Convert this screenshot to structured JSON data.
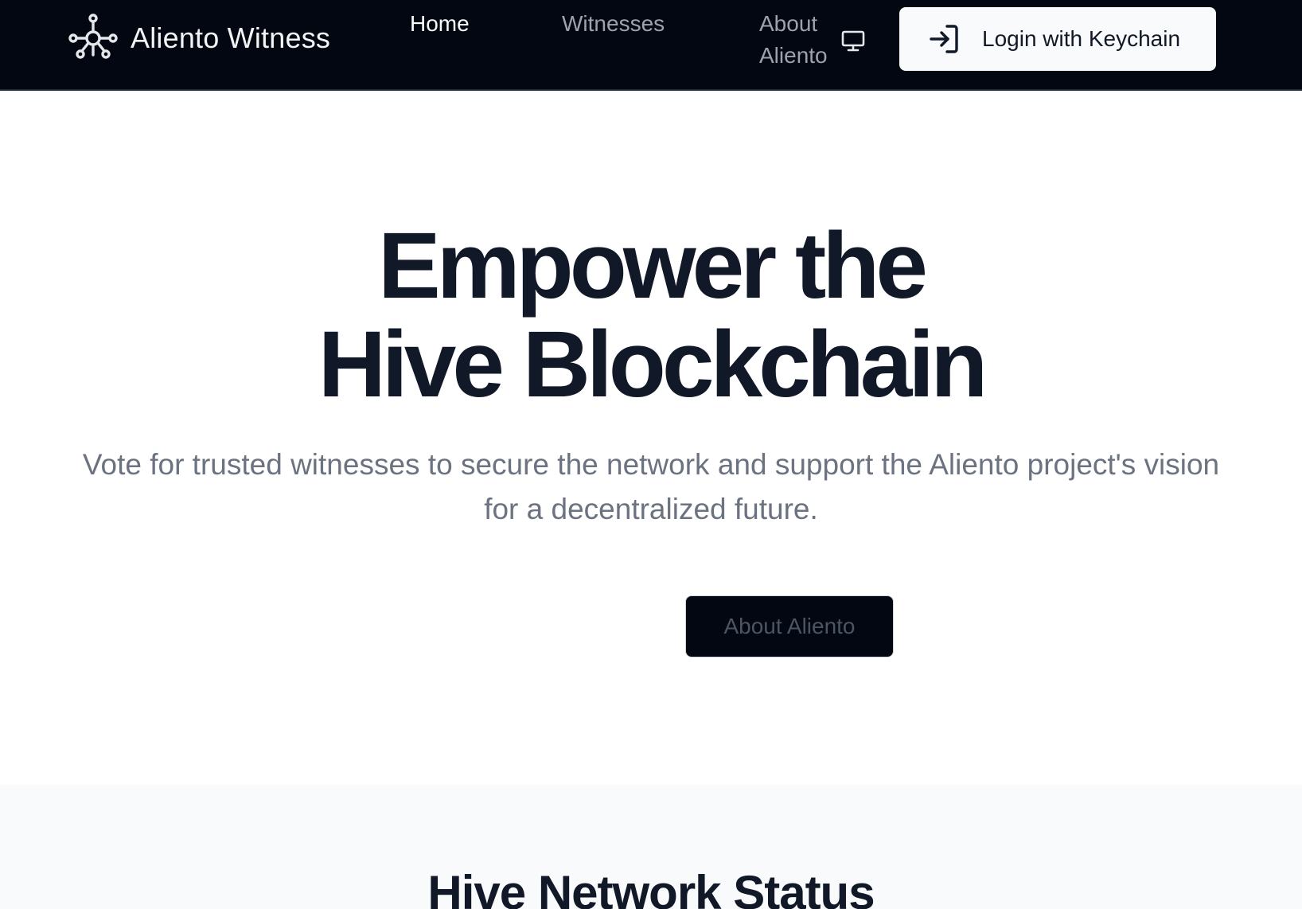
{
  "header": {
    "brand_name": "Aliento Witness",
    "brand_icon": "network-nodes-icon",
    "nav": {
      "home_label": "Home",
      "witnesses_label": "Witnesses",
      "about_label": "About Aliento",
      "about_icon": "monitor-icon"
    },
    "login_label": "Login with Keychain",
    "login_icon": "log-in-arrow-icon"
  },
  "hero": {
    "title_line1": "Empower the",
    "title_line2": "Hive Blockchain",
    "subtitle": "Vote for trusted witnesses to secure the network and support the Aliento project's vision for a decentralized future.",
    "about_button_label": "About Aliento"
  },
  "status": {
    "title": "Hive Network Status"
  },
  "colors": {
    "header_bg": "#030712",
    "text_dark": "#111827",
    "text_muted": "#6b7280",
    "nav_inactive": "#9ca3af",
    "section_bg": "#f9fafb"
  }
}
